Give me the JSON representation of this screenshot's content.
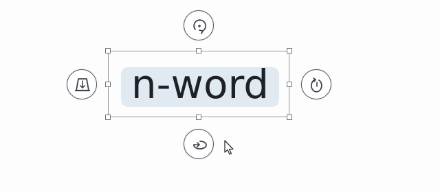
{
  "canvas": {
    "selected_text": "n-word"
  },
  "controls": {
    "rotate_top": "rotate-cw-icon",
    "flip_left": "perspective-flip-icon",
    "rotate_right": "rotate-ccw-icon",
    "spin_bottom": "spin-horizontal-icon"
  },
  "colors": {
    "frame": "#8d949c",
    "highlight": "#e1e9f1",
    "text": "#1e2228",
    "control_stroke": "#4a5058"
  }
}
